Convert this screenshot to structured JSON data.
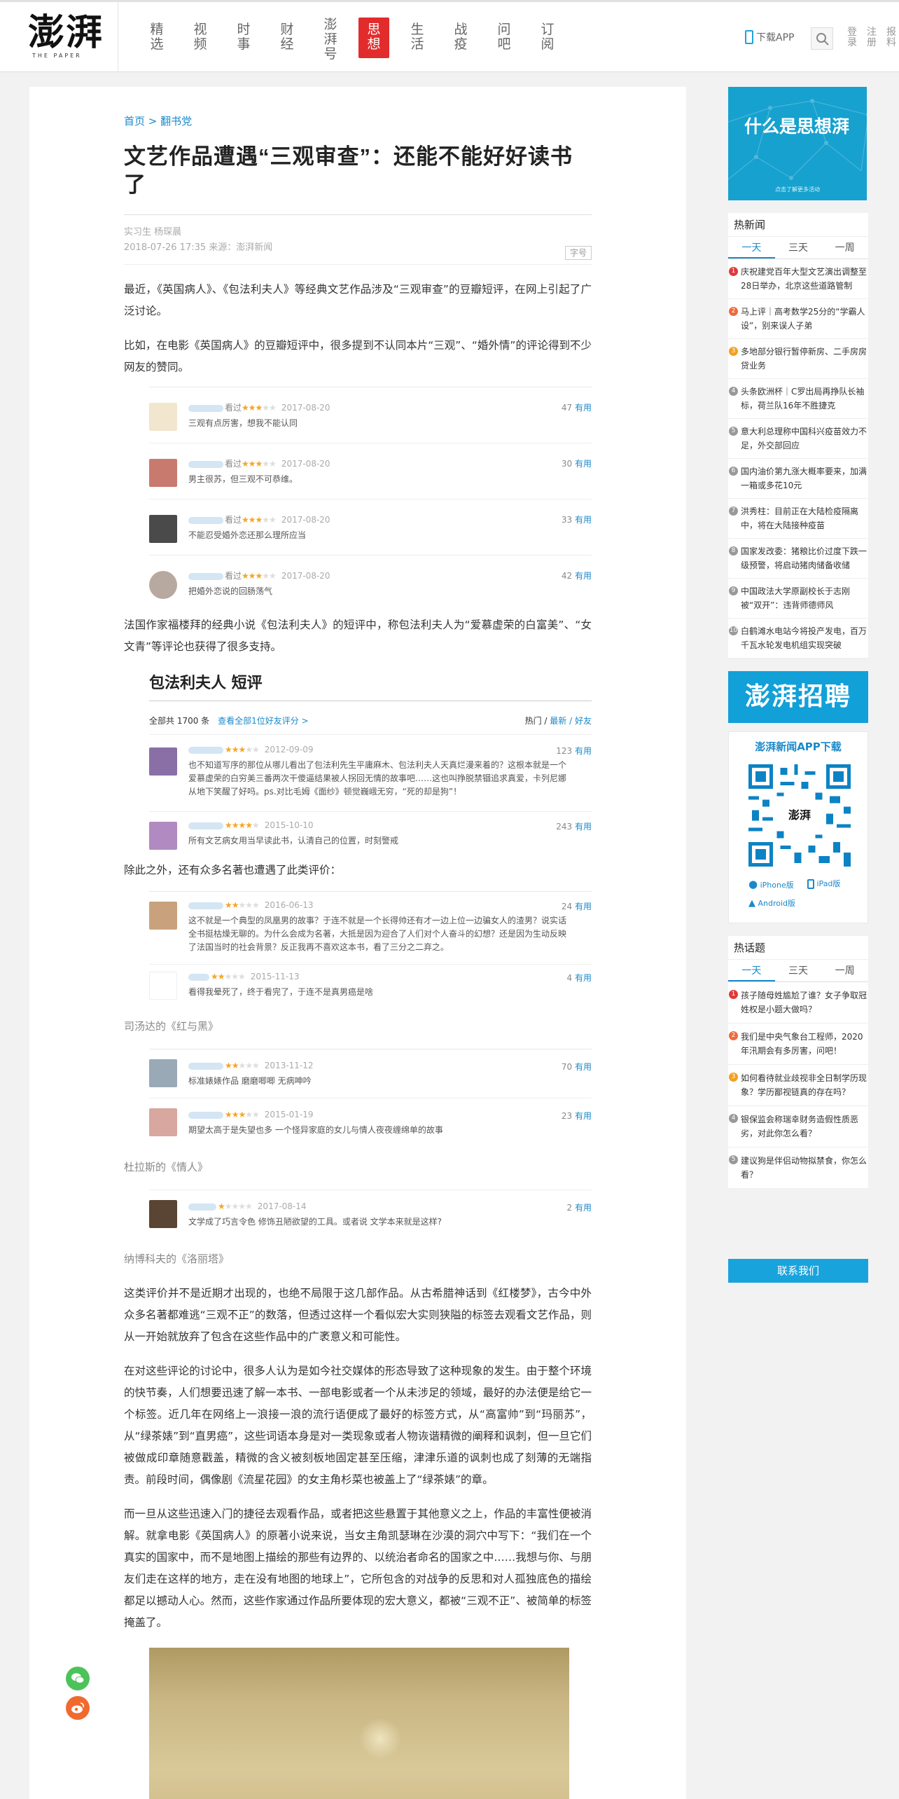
{
  "header": {
    "logo_text": "澎湃",
    "logo_sub": "THE PAPER",
    "nav": [
      {
        "label": "精选"
      },
      {
        "label": "视频"
      },
      {
        "label": "时事"
      },
      {
        "label": "财经"
      },
      {
        "label": "澎湃号"
      },
      {
        "label": "思想"
      },
      {
        "label": "生活"
      },
      {
        "label": "战疫"
      },
      {
        "label": "问吧"
      },
      {
        "label": "订阅"
      }
    ],
    "active_nav": "思想",
    "app_download": "下载APP",
    "login": "登录",
    "register": "注册",
    "report": "报料"
  },
  "article": {
    "breadcrumb": "首页 > 翻书党",
    "title": "文艺作品遭遇“三观审查”：还能不能好好读书了",
    "author": "实习生 杨琛晨",
    "date_source": "2018-07-26 17:35 来源：澎湃新闻",
    "font_size_label": "字号",
    "p1": "最近，《英国病人》、《包法利夫人》等经典文艺作品涉及“三观审查”的豆瓣短评，在网上引起了广泛讨论。",
    "p2": "比如，在电影《英国病人》的豆瓣短评中，很多提到不认同本片“三观”、“婚外情”的评论得到不少网友的赞同。",
    "p3": "法国作家福楼拜的经典小说《包法利夫人》的短评中，称包法利夫人为“爱慕虚荣的白富美”、“女文青”等评论也获得了很多支持。",
    "p4": "除此之外，还有众多名著也遭遇了此类评价：",
    "p5": "这类评价并不是近期才出现的，也绝不局限于这几部作品。从古希腊神话到《红楼梦》，古今中外众多名著都难逃“三观不正”的数落，但透过这样一个看似宏大实则狭隘的标签去观看文艺作品，则从一开始就放弃了包含在这些作品中的广袤意义和可能性。",
    "p6": "在对这些评论的讨论中，很多人认为是如今社交媒体的形态导致了这种现象的发生。由于整个环境的快节奏，人们想要迅速了解一本书、一部电影或者一个从未涉足的领域，最好的办法便是给它一个标签。近几年在网络上一浪接一浪的流行语便成了最好的标签方式，从“高富帅”到“玛丽苏”，从“绿茶婊”到“直男癌”，这些词语本身是对一类现象或者人物诙谐精微的阐释和讽刺，但一旦它们被做成印章随意戳盖，精微的含义被刻板地固定甚至压缩，津津乐道的讽刺也成了刻薄的无端指责。前段时间，偶像剧《流星花园》的女主角杉菜也被盖上了“绿茶婊”的章。",
    "p7": "而一旦从这些迅速入门的捷径去观看作品，或者把这些悬置于其他意义之上，作品的丰富性便被消解。就拿电影《英国病人》的原著小说来说，当女主角凯瑟琳在沙漠的洞穴中写下：“我们在一个真实的国家中，而不是地图上描绘的那些有边界的、以统治者命名的国家之中……我想与你、与朋友们走在这样的地方，走在没有地图的地球上”，它所包含的对战争的反思和对人孤独底色的描绘都足以撼动人心。然而，这些作家通过作品所要体现的宏大意义，都被“三观不正”、被简单的标签掩盖了。",
    "cap1": "司汤达的《红与黑》",
    "cap2": "杜拉斯的《情人》",
    "cap3": "纳博科夫的《洛丽塔》"
  },
  "reviews_english_patient": [
    {
      "action": "看过",
      "date": "2017-08-20",
      "text": "三观有点厉害，想我不能认同",
      "useful": "47",
      "useful_label": "有用",
      "avatar": "#f2e6cf"
    },
    {
      "action": "看过",
      "date": "2017-08-20",
      "text": "男主很苏，但三观不可恭维。",
      "useful": "30",
      "useful_label": "有用",
      "avatar": "#c97a6e"
    },
    {
      "action": "看过",
      "date": "2017-08-20",
      "text": "不能忍受婚外恋还那么理所应当",
      "useful": "33",
      "useful_label": "有用",
      "avatar": "#4a4a4a"
    },
    {
      "action": "看过",
      "date": "2017-08-20",
      "text": "把婚外恋说的回肠荡气",
      "useful": "42",
      "useful_label": "有用",
      "avatar": "#b8a9a0"
    }
  ],
  "madame_bovary": {
    "title": "包法利夫人 短评",
    "total": "全部共 1700 条",
    "friends_link": "查看全部1位好友评分 >",
    "sort_label": "热门 /",
    "sort_new": "最新",
    "sort_friends": "/ 好友",
    "reviews": [
      {
        "date": "2012-09-09",
        "text": "也不知道写序的那位从哪儿看出了包法利先生平庸麻木、包法利夫人天真烂漫来着的？这根本就是一个爱慕虚荣的白穷美三番两次干傻逼结果被人拐回无情的故事吧……这也叫挣脱禁锢追求真爱，卡列尼娜从地下笑醒了好吗。ps.对比毛姆《面纱》顿觉巍峨无穷，“死的却是狗”！",
        "useful": "123",
        "useful_label": "有用",
        "avatar": "#8a6fa6"
      },
      {
        "date": "2015-10-10",
        "text": "所有文艺病女用当早读此书，认清自己的位置，时刻警戒",
        "useful": "243",
        "useful_label": "有用",
        "avatar": "#b08ac0"
      }
    ]
  },
  "reviews_red_black": [
    {
      "date": "2016-06-13",
      "text": "这不就是一个典型的凤凰男的故事？于连不就是一个长得帅还有才一边上位一边骗女人的渣男？说实话全书挺枯燥无聊的。为什么会成为名著，大抵是因为迎合了人们对个人奋斗的幻想？还是因为生动反映了法国当时的社会背景？反正我再不喜欢这本书，看了三分之二弃之。",
      "useful": "24",
      "useful_label": "有用",
      "avatar": "#c9a27d"
    },
    {
      "date": "2015-11-13",
      "text": "看得我晕死了，终于看完了，于连不是真男癌是啥",
      "useful": "4",
      "useful_label": "有用",
      "avatar": "#ffffff"
    }
  ],
  "reviews_lover": [
    {
      "date": "2013-11-12",
      "text": "标准婊婊作品 磨磨唧唧 无病呻吟",
      "useful": "70",
      "useful_label": "有用",
      "avatar": "#9aa9b6"
    },
    {
      "date": "2015-01-19",
      "text": "期望太高于是失望也多 一个怪异家庭的女儿与情人夜夜缠绵单的故事",
      "useful": "23",
      "useful_label": "有用",
      "avatar": "#d7a7a0"
    }
  ],
  "reviews_lolita": [
    {
      "date": "2017-08-14",
      "text": "文学成了巧言令色 修饰丑陋欲望的工具。或者说 文学本来就是这样?",
      "useful": "2",
      "useful_label": "有用",
      "avatar": "#5a4434"
    }
  ],
  "sidebar": {
    "ad_title": "什么是思想湃",
    "ad_sub": "点击了解更多活动",
    "hot_news_title": "热新闻",
    "tabs": [
      "一天",
      "三天",
      "一周"
    ],
    "hot_news": [
      "庆祝建党百年大型文艺演出调整至28日举办，北京这些道路管制",
      "马上评｜高考数学25分的“学霸人设”，别来误人子弟",
      "多地部分银行暂停新房、二手房房贷业务",
      "头条欧洲杯｜C罗出局再挣队长袖标，荷兰队16年不胜捷克",
      "意大利总理称中国科兴疫苗效力不足，外交部回应",
      "国内油价第九涨大概率要来，加满一箱或多花10元",
      "洪秀柱：目前正在大陆检疫隔离中，将在大陆接种疫苗",
      "国家发改委：猪粮比价过度下跌一级预警，将启动猪肉储备收储",
      "中国政法大学原副校长于志刚被“双开”：违背师德师风",
      "白鹤滩水电站今将投产发电，百万千瓦水轮发电机组实现突破"
    ],
    "recruit": "澎湃招聘",
    "app_title": "澎湃新闻APP下载",
    "qr_logo": "澎湃",
    "iphone": "iPhone版",
    "ipad": "iPad版",
    "android": "Android版",
    "hot_topics_title": "热话题",
    "hot_topics": [
      "孩子随母姓尴尬了谁？女子争取冠姓权是小题大做吗？",
      "我们是中央气象台工程师，2020年汛期会有多厉害，问吧！",
      "如何看待就业歧视非全日制学历现象？学历鄙视链真的存在吗？",
      "银保监会称瑞幸财务造假性质恶劣，对此你怎么看？",
      "建议狗是伴侣动物拟禁食，你怎么看？"
    ],
    "contact": "联系我们"
  },
  "colors": {
    "accent": "#1b89c9",
    "active_nav": "#e22c2c",
    "star": "#f5a623",
    "recruit": "#12a0d8"
  }
}
